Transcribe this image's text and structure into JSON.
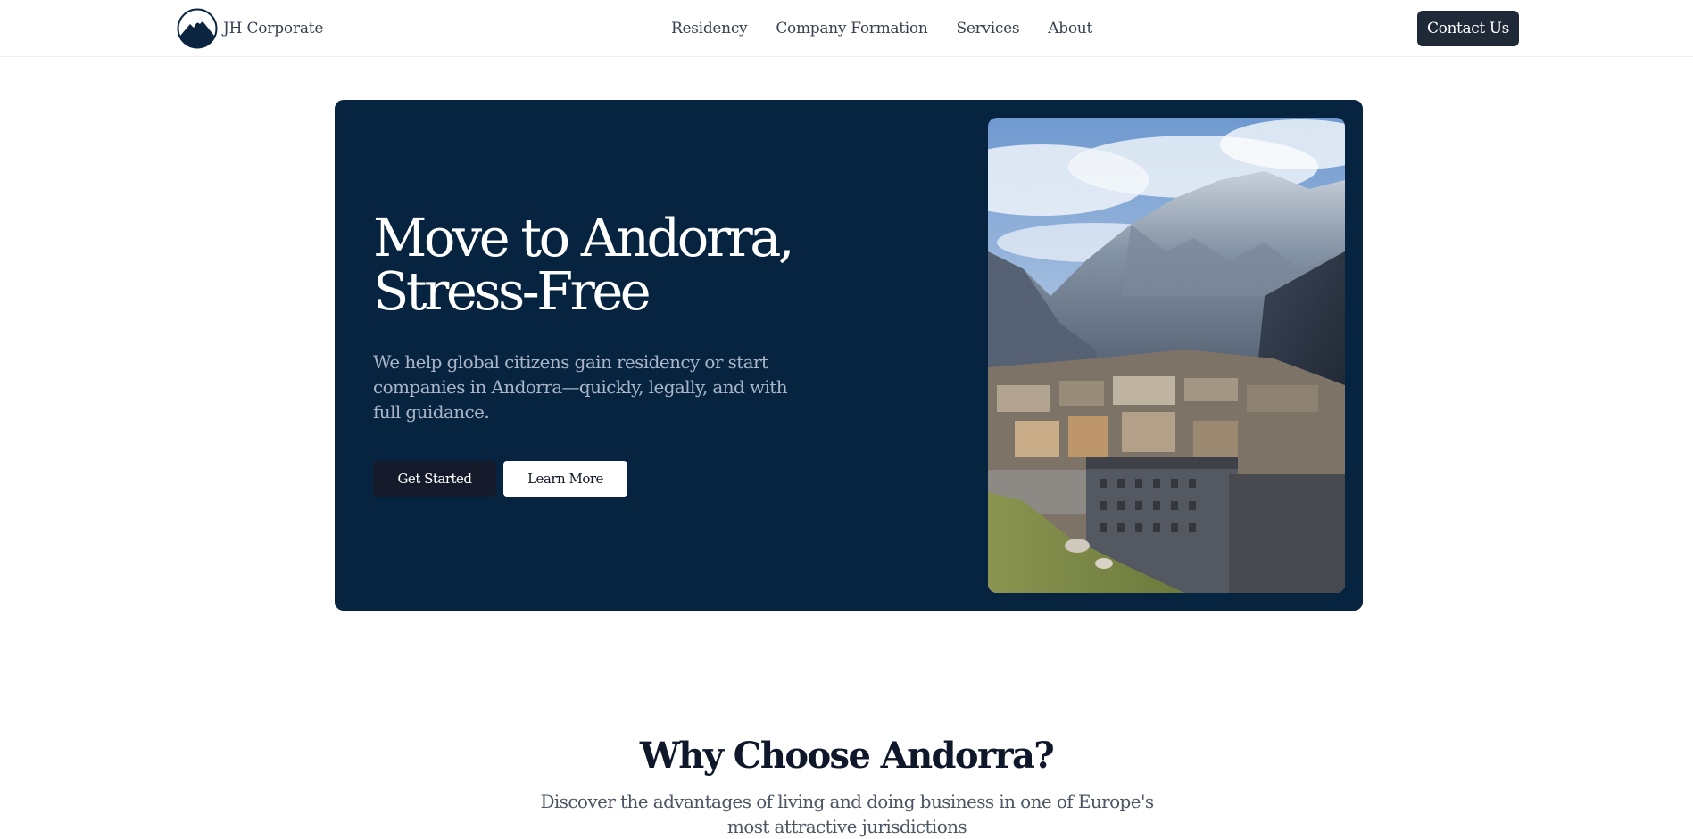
{
  "header": {
    "brand_name": "JH Corporate",
    "logo_icon": "mountain-circle-icon",
    "nav": [
      {
        "label": "Residency"
      },
      {
        "label": "Company Formation"
      },
      {
        "label": "Services"
      },
      {
        "label": "About"
      }
    ],
    "contact_label": "Contact Us"
  },
  "hero": {
    "title_line1": "Move to Andorra,",
    "title_line2": "Stress-Free",
    "subtitle": "We help global citizens gain residency or start companies in Andorra—quickly, legally, and with full guidance.",
    "primary_label": "Get Started",
    "secondary_label": "Learn More",
    "image_subject": "mountain-valley-town-photo"
  },
  "why": {
    "title": "Why Choose Andorra?",
    "subtitle": "Discover the advantages of living and doing business in one of Europe's most attractive jurisdictions"
  },
  "colors": {
    "hero_bg": "#062340",
    "button_dark": "#1f2937",
    "text_dark": "#0f172a",
    "text_muted": "#4b5563",
    "hero_sub_text": "#aab6c8"
  }
}
